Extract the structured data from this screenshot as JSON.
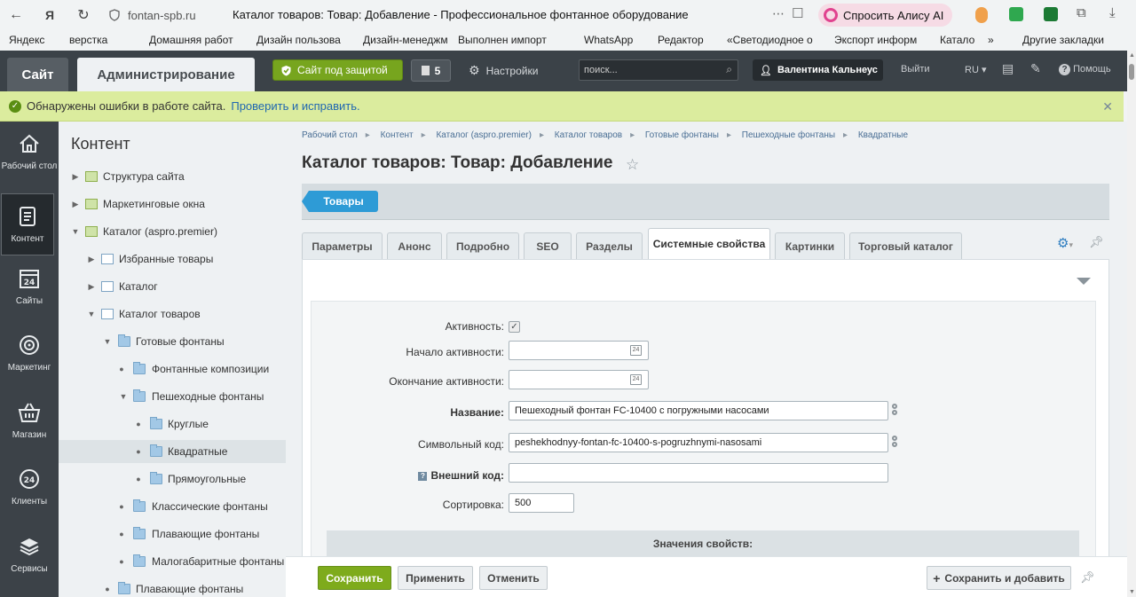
{
  "browser": {
    "url": "fontan-spb.ru",
    "page_title": "Каталог товаров: Товар: Добавление - Профессиональное фонтанное оборудование",
    "alisa": "Спросить Алису AI"
  },
  "bookmarks": [
    "Яндекс",
    "верстка",
    "Домашняя работ",
    "Дизайн пользова",
    "Дизайн-менеджм",
    "Выполнен импорт",
    "WhatsApp",
    "Редактор",
    "«Светодиодное о",
    "Экспорт информ",
    "Катало",
    "»",
    "Другие закладки"
  ],
  "adminbar": {
    "site_tab": "Сайт",
    "admin_tab": "Администрирование",
    "secure_label": "Сайт под защитой",
    "notif_count": "5",
    "settings_label": "Настройки",
    "search_placeholder": "поиск...",
    "user_name": "Валентина Кальнеус",
    "logout": "Выйти",
    "lang": "RU",
    "help": "Помощь"
  },
  "alert": {
    "text": "Обнаружены ошибки в работе сайта.",
    "link": "Проверить и исправить."
  },
  "leftnav": [
    {
      "label": "Рабочий стол",
      "icon": "home-icon"
    },
    {
      "label": "Контент",
      "icon": "document-icon"
    },
    {
      "label": "Сайты",
      "icon": "calendar-icon"
    },
    {
      "label": "Маркетинг",
      "icon": "target-icon"
    },
    {
      "label": "Магазин",
      "icon": "basket-icon"
    },
    {
      "label": "Клиенты",
      "icon": "clients-icon"
    },
    {
      "label": "Сервисы",
      "icon": "layers-icon"
    }
  ],
  "tree": {
    "title": "Контент",
    "nodes": [
      {
        "label": "Структура сайта"
      },
      {
        "label": "Маркетинговые окна"
      },
      {
        "label": "Каталог (aspro.premier)"
      },
      {
        "label": "Избранные товары"
      },
      {
        "label": "Каталог"
      },
      {
        "label": "Каталог товаров"
      },
      {
        "label": "Готовые фонтаны"
      },
      {
        "label": "Фонтанные композиции"
      },
      {
        "label": "Пешеходные фонтаны"
      },
      {
        "label": "Круглые"
      },
      {
        "label": "Квадратные"
      },
      {
        "label": "Прямоугольные"
      },
      {
        "label": "Классические фонтаны"
      },
      {
        "label": "Плавающие фонтаны"
      },
      {
        "label": "Малогабаритные фонтаны"
      },
      {
        "label": "Плавающие фонтаны"
      }
    ]
  },
  "breadcrumbs": [
    "Рабочий стол",
    "Контент",
    "Каталог (aspro.premier)",
    "Каталог товаров",
    "Готовые фонтаны",
    "Пешеходные фонтаны",
    "Квадратные"
  ],
  "page": {
    "title": "Каталог товаров: Товар: Добавление",
    "goods_button": "Товары"
  },
  "tabs": [
    "Параметры",
    "Анонс",
    "Подробно",
    "SEO",
    "Разделы",
    "Системные свойства",
    "Картинки",
    "Торговый каталог"
  ],
  "form": {
    "active_label": "Активность:",
    "start_label": "Начало активности:",
    "end_label": "Окончание активности:",
    "name_label": "Название:",
    "name_value": "Пешеходный фонтан FC-10400 с погружными насосами",
    "code_label": "Символьный код:",
    "code_value": "peshekhodnyy-fontan-fc-10400-s-pogruzhnymi-nasosami",
    "ext_code_label": "Внешний код:",
    "ext_code_value": "",
    "sort_label": "Сортировка:",
    "sort_value": "500",
    "props_header": "Значения свойств:"
  },
  "footer": {
    "save": "Сохранить",
    "apply": "Применить",
    "cancel": "Отменить",
    "save_add": "Сохранить и добавить"
  }
}
